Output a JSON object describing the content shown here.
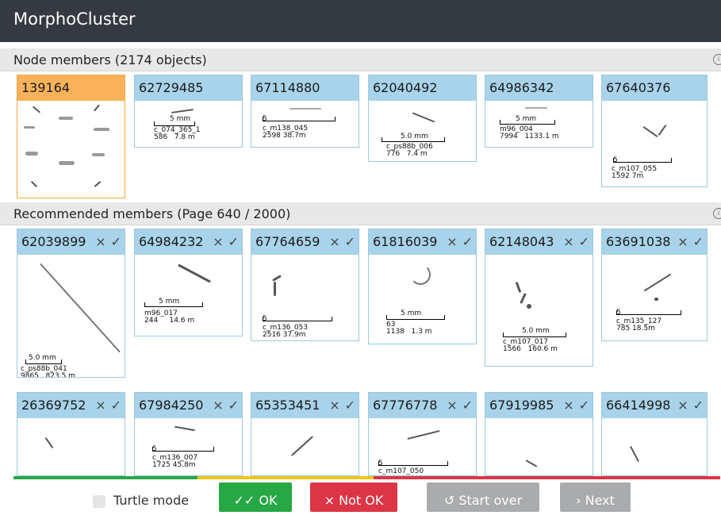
{
  "app": {
    "title": "MorphoCluster"
  },
  "node_members": {
    "title": "Node members (2174 objects)",
    "info_icon": "info-icon",
    "cards": [
      {
        "id": "139164",
        "selected": true
      },
      {
        "id": "62729485",
        "scale_label": "5 mm",
        "meta": "c_074_365_1\n586   7.8 m"
      },
      {
        "id": "67114880",
        "scale_label": "5",
        "meta": "c_m138_045\n2598 38.7m"
      },
      {
        "id": "62040492",
        "scale_label": "5.0 mm",
        "meta": "c_ps88b_006\n776   7.4 m"
      },
      {
        "id": "64986342",
        "scale_label": "5 mm",
        "meta": "m96_004\n7994   1133.1 m"
      },
      {
        "id": "67640376",
        "scale_label": "5",
        "meta": "c_m107_055\n1592 7m"
      }
    ]
  },
  "recommended": {
    "title": "Recommended members (Page 640 / 2000)",
    "info_icon": "info-icon",
    "reject_glyph": "×",
    "accept_glyph": "✓",
    "row1": [
      {
        "id": "62039899",
        "scale_label": "5.0 mm",
        "meta": "c_ps88b_041\n9865   823.5 m"
      },
      {
        "id": "64984232",
        "scale_label": "5 mm",
        "meta": "m96_017\n244     14.6 m"
      },
      {
        "id": "67764659",
        "scale_label": "5",
        "meta": "c_m136_053\n2516 37.9m"
      },
      {
        "id": "61816039",
        "scale_label": "5 mm",
        "meta": "63\n1138   1.3 m"
      },
      {
        "id": "62148043",
        "scale_label": "5.0 mm",
        "meta": "c_m107_017\n1566   160.6 m"
      },
      {
        "id": "63691038",
        "scale_label": "5",
        "meta": "c_m135_127\n785 18.5m"
      }
    ],
    "row2": [
      {
        "id": "26369752"
      },
      {
        "id": "67984250",
        "scale_label": "5",
        "meta": "c_m136_007\n1725 45.8m"
      },
      {
        "id": "65353451"
      },
      {
        "id": "67776778",
        "scale_label": "5",
        "meta": "c_m107_050"
      },
      {
        "id": "67919985"
      },
      {
        "id": "66414998"
      }
    ]
  },
  "progress": {
    "green": 0.26,
    "yellow": 0.25,
    "red": 0.49,
    "colors": [
      "#28a745",
      "#f0c419",
      "#dc3545"
    ]
  },
  "footer": {
    "turtle_label": "Turtle mode",
    "ok_label": "✓✓ OK",
    "notok_label": "× Not OK",
    "start_label": "↺ Start over",
    "next_label": "› Next"
  }
}
